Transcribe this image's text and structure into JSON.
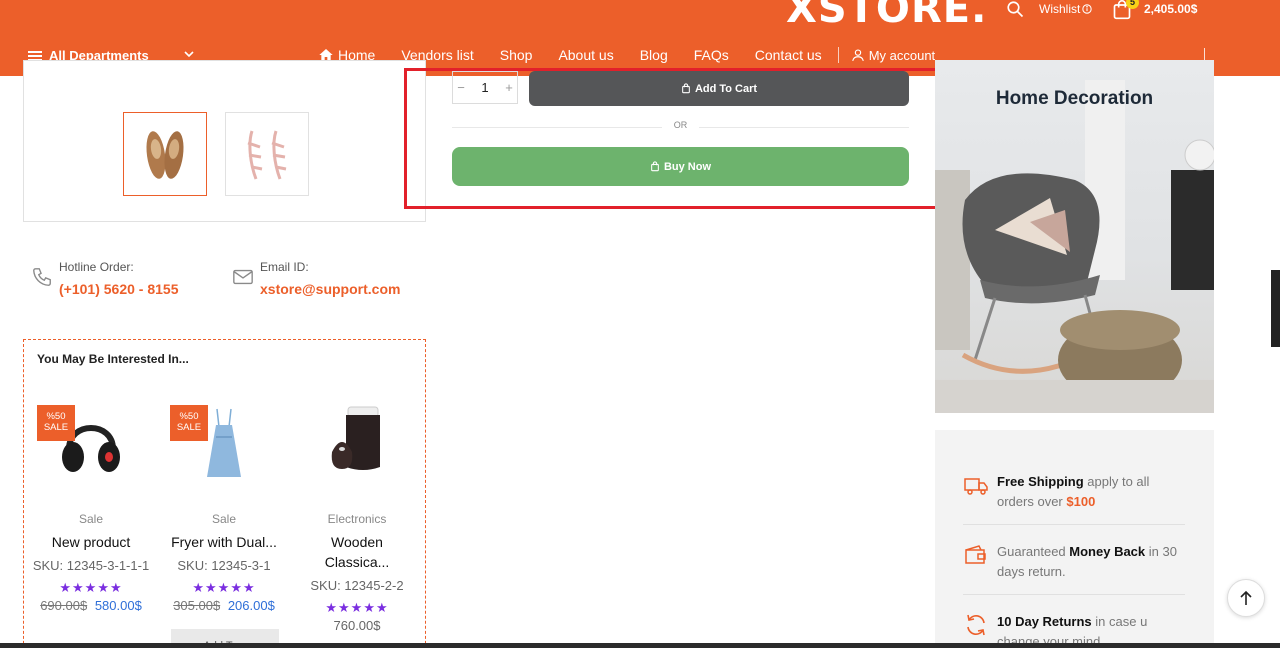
{
  "header": {
    "logo": "XSTORE.",
    "wishlist_label": "Wishlist",
    "cart_count": "5",
    "cart_total": "2,405.00$",
    "departments_label": "All Departments",
    "nav": [
      "Home",
      "Vendors list",
      "Shop",
      "About us",
      "Blog",
      "FAQs",
      "Contact us"
    ],
    "account_label": "My account"
  },
  "product": {
    "quantity": "1",
    "add_to_cart": "Add To Cart",
    "or_label": "OR",
    "buy_now": "Buy Now"
  },
  "contact": {
    "hotline_label": "Hotline Order:",
    "hotline_value": "(+101) 5620 - 8155",
    "email_label": "Email ID:",
    "email_value": "xstore@support.com"
  },
  "interest": {
    "title": "You May Be Interested In...",
    "products": [
      {
        "category": "Sale",
        "name": "New product",
        "sku": "SKU: 12345-3-1-1-1",
        "old_price": "690.00$",
        "price": "580.00$",
        "badge": "%50 SALE",
        "stars": "★★★★★"
      },
      {
        "category": "Sale",
        "name": "Fryer with Dual...",
        "sku": "SKU: 12345-3-1",
        "old_price": "305.00$",
        "price": "206.00$",
        "badge": "%50 SALE",
        "stars": "★★★★★"
      },
      {
        "category": "Electronics",
        "name": "Wooden Classica...",
        "sku": "SKU: 12345-2-2",
        "price": "760.00$",
        "stars": "★★★★★"
      }
    ],
    "add_button_stub": "Add To..."
  },
  "banner": {
    "title": "Home Decoration"
  },
  "features": {
    "shipping": {
      "bold": "Free Shipping",
      "text": " apply to all orders over ",
      "highlight": "$100"
    },
    "money": {
      "pre": "Guaranteed ",
      "bold": "Money Back",
      "text": " in 30 days return."
    },
    "returns": {
      "bold": "10 Day Returns",
      "text": " in case u change your mind"
    }
  },
  "colors": {
    "brand": "#ec5f2a",
    "add_to_cart_bg": "#555658",
    "buy_now_bg": "#6db36d",
    "highlight_box": "#e2202a",
    "stars": "#7a2ee0"
  }
}
